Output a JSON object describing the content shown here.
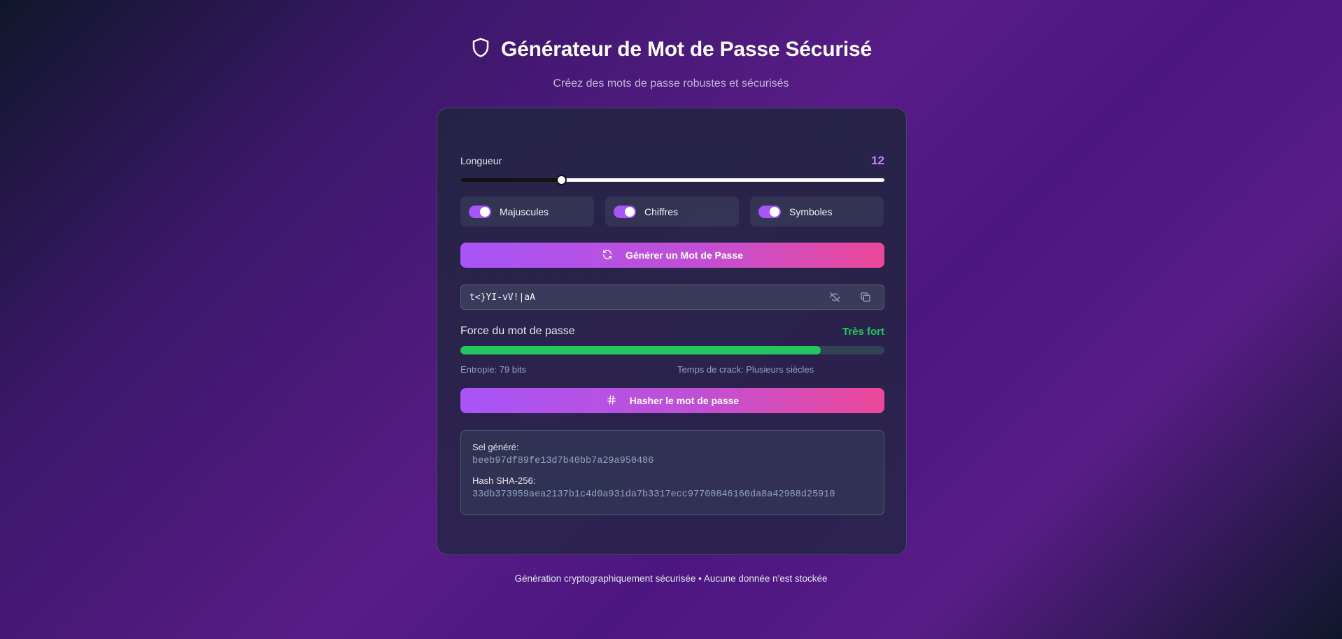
{
  "header": {
    "title": "Générateur de Mot de Passe Sécurisé",
    "subtitle": "Créez des mots de passe robustes et sécurisés",
    "icon": "shield-icon"
  },
  "length": {
    "label": "Longueur",
    "value": "12",
    "min": 4,
    "max": 64,
    "level_fraction": 0.237
  },
  "options": [
    {
      "label": "Majuscules",
      "checked": true
    },
    {
      "label": "Chiffres",
      "checked": true
    },
    {
      "label": "Symboles",
      "checked": true
    }
  ],
  "generate_button": {
    "label": "Générer un Mot de Passe",
    "icon": "refresh-icon"
  },
  "password": {
    "value": "t<}YI-vV!|aA",
    "toggle_icon": "eye-off-icon",
    "copy_icon": "copy-icon"
  },
  "strength": {
    "label": "Force du mot de passe",
    "value": "Très fort",
    "percent": 85,
    "color": "#22c55e"
  },
  "stats": {
    "entropy": "Entropie: 79 bits",
    "crack_time": "Temps de crack: Plusieurs siècles"
  },
  "hash_button": {
    "label": "Hasher le mot de passe",
    "icon": "hash-icon"
  },
  "hash_result": {
    "salt_label": "Sel généré:",
    "salt_value": "beeb97df89fe13d7b40bb7a29a950486",
    "hash_label": "Hash SHA-256:",
    "hash_value": "33db373959aea2137b1c4d0a931da7b3317ecc97700846160da8a42988d25910"
  },
  "footer": "Génération cryptographiquement sécurisée • Aucune donnée n'est stockée",
  "colors": {
    "accent": "#a855f7",
    "accent_pink": "#ec4899",
    "length_value": "#c084fc",
    "strength": "#22c55e"
  }
}
